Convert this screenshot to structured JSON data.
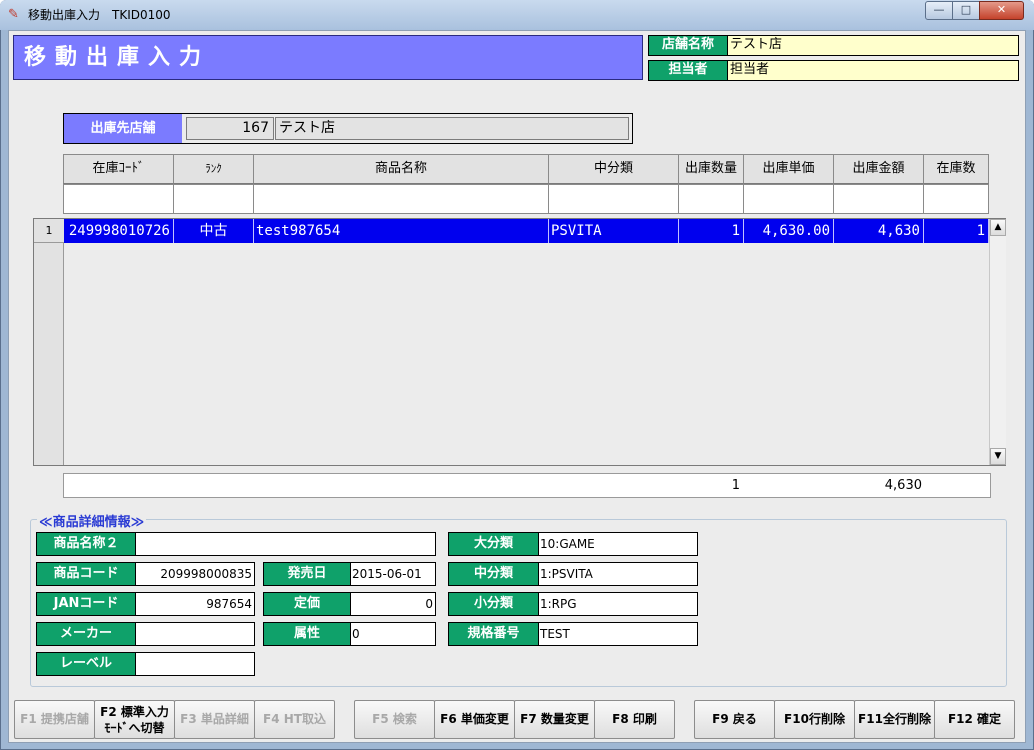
{
  "window": {
    "title": "移動出庫入力　TKID0100",
    "minimize": "—",
    "maximize": "□",
    "close": "✕"
  },
  "header": {
    "page_title": "移動出庫入力",
    "store_label": "店舗名称",
    "store_value": "テスト店",
    "staff_label": "担当者",
    "staff_value": "担当者"
  },
  "destination": {
    "label": "出庫先店舗",
    "code": "167",
    "name": "テスト店"
  },
  "grid": {
    "columns": [
      "在庫ｺｰﾄﾞ",
      "ﾗﾝｸ",
      "商品名称",
      "中分類",
      "出庫数量",
      "出庫単価",
      "出庫金額",
      "在庫数"
    ],
    "rows": [
      {
        "num": "1",
        "stock_code": "249998010726",
        "rank": "中古",
        "product_name": "test987654",
        "category": "PSVITA",
        "qty": "1",
        "unit_price": "4,630.00",
        "amount": "4,630",
        "stock": "1"
      }
    ],
    "scroll_up": "▲",
    "scroll_down": "▼"
  },
  "totals": {
    "qty": "1",
    "amount": "4,630"
  },
  "detail": {
    "title": "≪商品詳細情報≫",
    "name2_label": "商品名称２",
    "name2_value": "",
    "product_code_label": "商品コード",
    "product_code_value": "209998000835",
    "jan_label": "JANコード",
    "jan_value": "987654",
    "maker_label": "メーカー",
    "maker_value": "",
    "label_label": "レーベル",
    "label_value": "",
    "release_label": "発売日",
    "release_value": "2015-06-01",
    "list_price_label": "定価",
    "list_price_value": "0",
    "attribute_label": "属性",
    "attribute_value": "0",
    "major_label": "大分類",
    "major_value": "10:GAME",
    "middle_label": "中分類",
    "middle_value": "1:PSVITA",
    "minor_label": "小分類",
    "minor_value": "1:RPG",
    "spec_label": "規格番号",
    "spec_value": "TEST"
  },
  "fkeys": {
    "f1": "F1 提携店舗",
    "f2_line1": "F2 標準入力",
    "f2_line2": "ﾓｰﾄﾞへ切替",
    "f3": "F3 単品詳細",
    "f4": "F4 HT取込",
    "f5": "F5 検索",
    "f6": "F6 単価変更",
    "f7": "F7 数量変更",
    "f8": "F8 印刷",
    "f9": "F9 戻る",
    "f10": "F10行削除",
    "f11": "F11全行削除",
    "f12": "F12 確定"
  },
  "colors": {
    "title_bg": "#7b7bff",
    "label_green": "#0fa16a",
    "selected_row": "#0000ee",
    "value_yellow": "#ffffcc"
  }
}
